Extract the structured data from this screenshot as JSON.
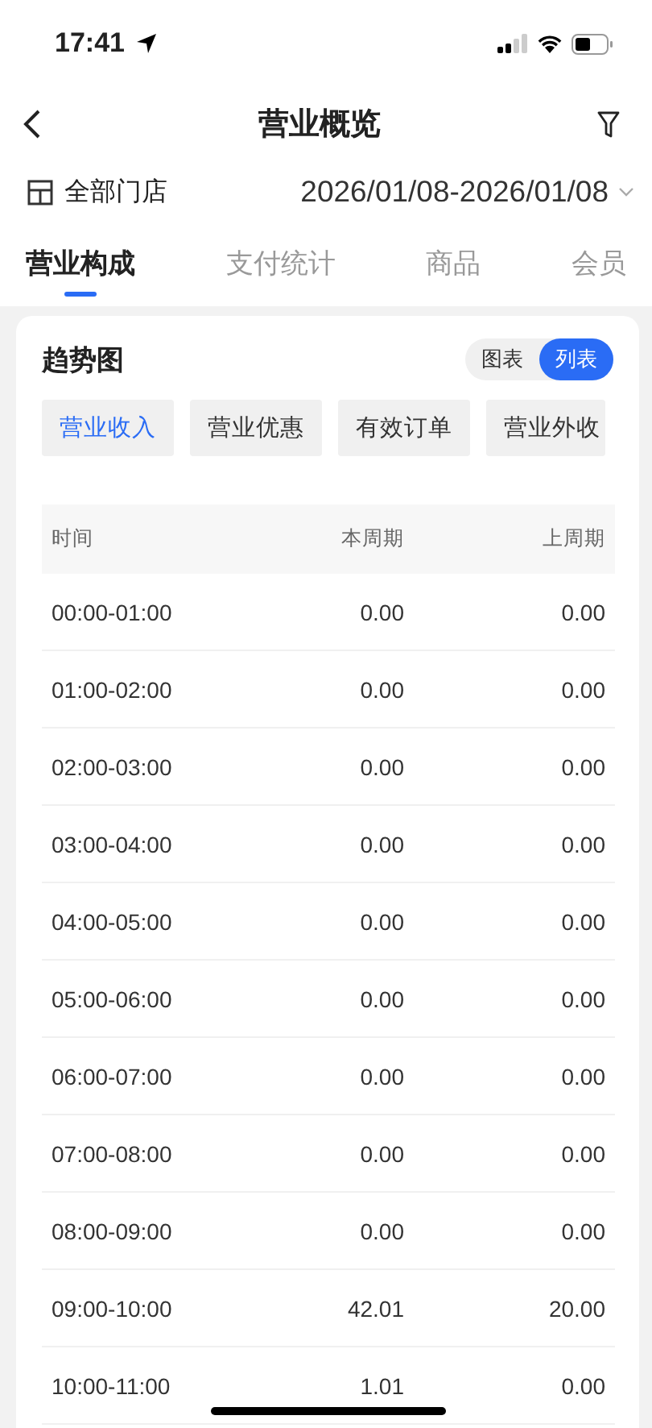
{
  "status_bar": {
    "time": "17:41"
  },
  "nav": {
    "title": "营业概览"
  },
  "store_filter": {
    "label": "全部门店",
    "date_range": "2026/01/08-2026/01/08"
  },
  "tabs": [
    {
      "label": "营业构成",
      "selected": true
    },
    {
      "label": "支付统计",
      "selected": false
    },
    {
      "label": "商品",
      "selected": false
    },
    {
      "label": "会员",
      "selected": false
    }
  ],
  "card": {
    "title": "趋势图",
    "view_toggle": [
      {
        "label": "图表",
        "selected": false
      },
      {
        "label": "列表",
        "selected": true
      }
    ],
    "metrics": [
      {
        "label": "营业收入",
        "selected": true
      },
      {
        "label": "营业优惠",
        "selected": false
      },
      {
        "label": "有效订单",
        "selected": false
      },
      {
        "label": "营业外收",
        "selected": false
      }
    ],
    "table": {
      "columns": [
        "时间",
        "本周期",
        "上周期"
      ],
      "rows": [
        [
          "00:00-01:00",
          "0.00",
          "0.00"
        ],
        [
          "01:00-02:00",
          "0.00",
          "0.00"
        ],
        [
          "02:00-03:00",
          "0.00",
          "0.00"
        ],
        [
          "03:00-04:00",
          "0.00",
          "0.00"
        ],
        [
          "04:00-05:00",
          "0.00",
          "0.00"
        ],
        [
          "05:00-06:00",
          "0.00",
          "0.00"
        ],
        [
          "06:00-07:00",
          "0.00",
          "0.00"
        ],
        [
          "07:00-08:00",
          "0.00",
          "0.00"
        ],
        [
          "08:00-09:00",
          "0.00",
          "0.00"
        ],
        [
          "09:00-10:00",
          "42.01",
          "20.00"
        ],
        [
          "10:00-11:00",
          "1.01",
          "0.00"
        ]
      ]
    }
  }
}
